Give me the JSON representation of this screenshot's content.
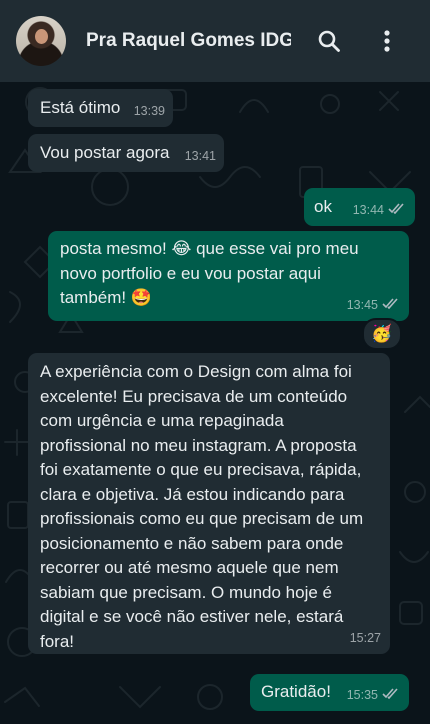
{
  "header": {
    "contact_name": "Pra Raquel Gomes IDG",
    "avatar_icon": "contact-avatar",
    "search_icon": "search-icon",
    "menu_icon": "more-vert-icon"
  },
  "colors": {
    "header_bg": "#202c33",
    "chat_bg": "#0b141a",
    "incoming_bubble": "#202c33",
    "outgoing_bubble": "#005c4b"
  },
  "messages": [
    {
      "direction": "in",
      "text": "Está ótimo",
      "time": "13:39"
    },
    {
      "direction": "in",
      "text": "Vou postar agora",
      "time": "13:41"
    },
    {
      "direction": "out",
      "text": "ok",
      "time": "13:44",
      "status": "read"
    },
    {
      "direction": "out",
      "lines": [
        "posta mesmo! 😂 que esse vai pro meu",
        "novo portfolio e eu vou postar aqui",
        "também! 🤩"
      ],
      "time": "13:45",
      "status": "read",
      "reaction": "🥳"
    },
    {
      "direction": "in",
      "lines": [
        "A experiência com o Design com alma foi",
        "excelente! Eu precisava de um conteúdo",
        "com urgência e uma repaginada",
        "profissional no meu instagram. A proposta",
        "foi exatamente o que eu precisava, rápida,",
        "clara e objetiva. Já estou indicando para",
        "profissionais como eu que precisam de um",
        "posicionamento e não sabem para onde",
        "recorrer ou até mesmo aquele que nem",
        "sabiam que precisam. O mundo hoje é",
        "digital e se você não estiver nele, estará",
        "fora!"
      ],
      "time": "15:27"
    },
    {
      "direction": "out",
      "text": "Gratidão!",
      "time": "15:35",
      "status": "read"
    }
  ]
}
